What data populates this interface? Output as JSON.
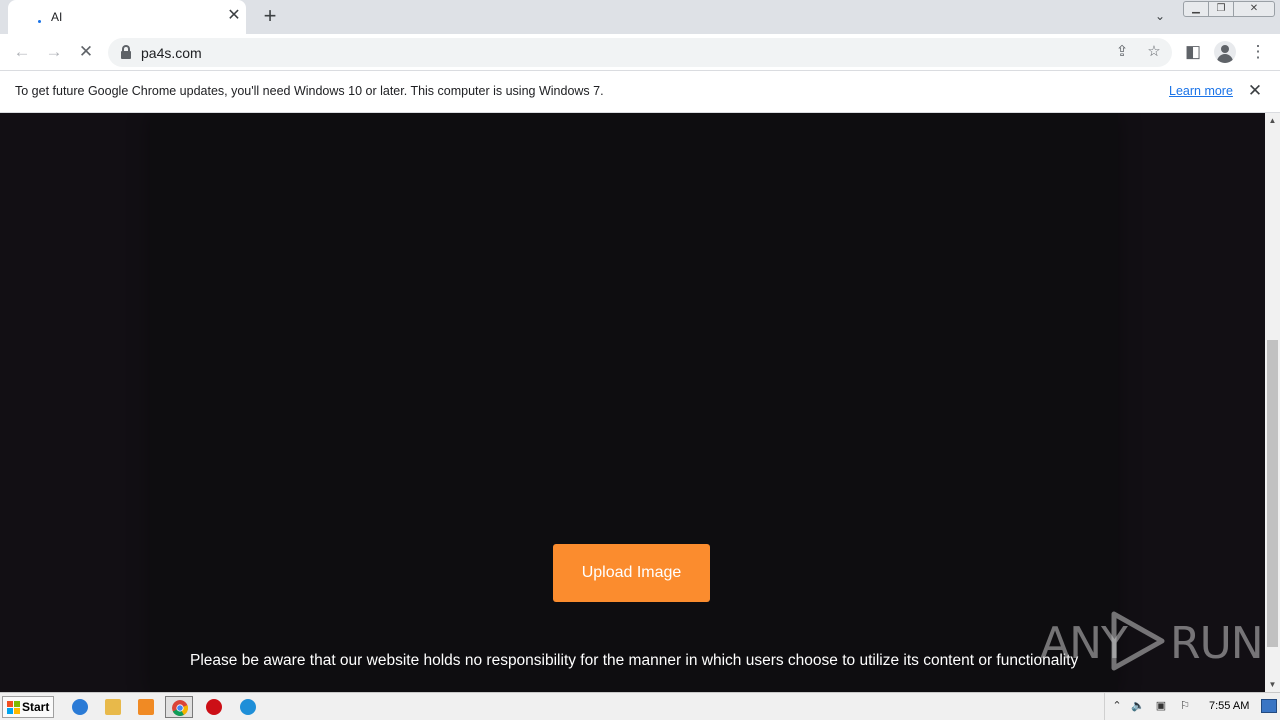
{
  "browser": {
    "tab": {
      "title": "AI",
      "close_glyph": "✕"
    },
    "new_tab_glyph": "+",
    "tab_list_glyph": "⌄",
    "window_controls": {
      "min_glyph": "▁",
      "max_glyph": "❐",
      "close_glyph": "✕"
    },
    "nav": {
      "back_glyph": "←",
      "forward_glyph": "→",
      "stop_glyph": "✕"
    },
    "address": {
      "url": "pa4s.com"
    },
    "omnibox_icons": {
      "share_glyph": "⇪",
      "bookmark_glyph": "☆"
    },
    "side_panel_glyph": "◧",
    "menu_glyph": "⋮"
  },
  "infobar": {
    "message": "To get future Google Chrome updates, you'll need Windows 10 or later. This computer is using Windows 7.",
    "link_label": "Learn more",
    "close_glyph": "✕"
  },
  "page": {
    "upload_button_label": "Upload Image",
    "disclaimer": "Please be aware that our website holds no responsibility for the manner in which users choose to utilize its content or functionality",
    "watermark": {
      "left": "ANY",
      "right": "RUN"
    }
  },
  "scrollbar": {
    "up_glyph": "▲",
    "down_glyph": "▼"
  },
  "taskbar": {
    "start_label": "Start",
    "apps": [
      {
        "name": "internet-explorer",
        "color": "#2b7bd6"
      },
      {
        "name": "file-explorer",
        "color": "#e8b94a"
      },
      {
        "name": "media-player",
        "color": "#f08a24"
      },
      {
        "name": "chrome",
        "color": "#db4437"
      },
      {
        "name": "opera",
        "color": "#cc0f16"
      },
      {
        "name": "edge",
        "color": "#1f8fd8"
      }
    ],
    "tray": {
      "expand_glyph": "⌃",
      "volume_glyph": "🔈",
      "network_glyph": "▣",
      "flag_glyph": "⚐"
    },
    "clock": "7:55 AM"
  },
  "colors": {
    "accent_orange": "#fb8c2e",
    "page_background": "#120f14",
    "panel_background": "#0e0d10",
    "link_blue": "#1a73e8"
  }
}
